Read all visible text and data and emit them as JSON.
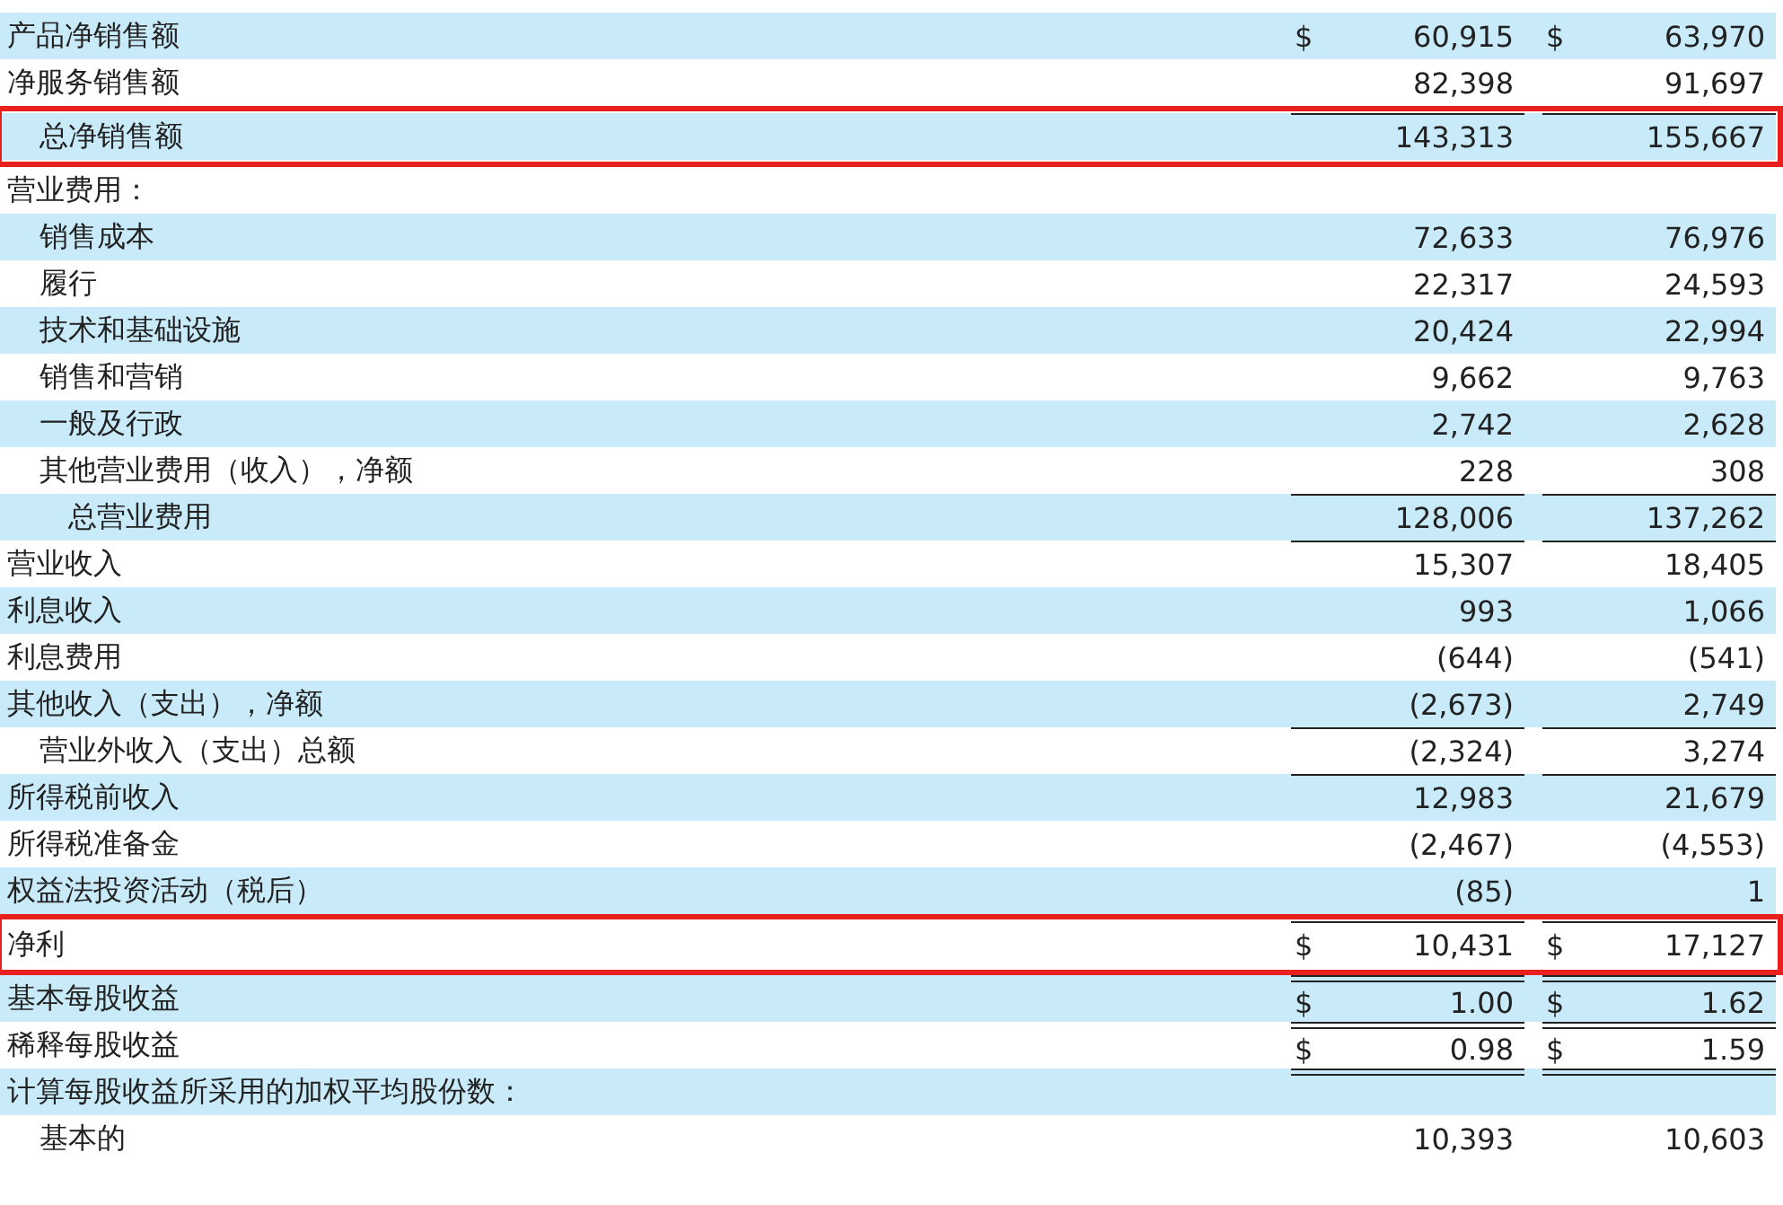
{
  "table": {
    "rows": [
      {
        "label": "产品净销售额",
        "kind": "line",
        "values": [
          {
            "currency": "$",
            "amount": "60,915"
          },
          {
            "currency": "$",
            "amount": "63,970"
          }
        ]
      },
      {
        "label": "净服务销售额",
        "kind": "line",
        "values": [
          {
            "amount": "82,398"
          },
          {
            "amount": "91,697"
          }
        ]
      },
      {
        "label": "总净销售额",
        "kind": "total",
        "rule_above": true,
        "highlighted": true,
        "values": [
          {
            "amount": "143,313"
          },
          {
            "amount": "155,667"
          }
        ]
      },
      {
        "label": "营业费用：",
        "kind": "header",
        "children": [
          {
            "label": "销售成本",
            "kind": "line",
            "values": [
              {
                "amount": "72,633"
              },
              {
                "amount": "76,976"
              }
            ]
          },
          {
            "label": "履行",
            "kind": "line",
            "values": [
              {
                "amount": "22,317"
              },
              {
                "amount": "24,593"
              }
            ]
          },
          {
            "label": "技术和基础设施",
            "kind": "line",
            "values": [
              {
                "amount": "20,424"
              },
              {
                "amount": "22,994"
              }
            ]
          },
          {
            "label": "销售和营销",
            "kind": "line",
            "values": [
              {
                "amount": "9,662"
              },
              {
                "amount": "9,763"
              }
            ]
          },
          {
            "label": "一般及行政",
            "kind": "line",
            "values": [
              {
                "amount": "2,742"
              },
              {
                "amount": "2,628"
              }
            ]
          },
          {
            "label": "其他营业费用（收入），净额",
            "kind": "line",
            "values": [
              {
                "amount": "228"
              },
              {
                "amount": "308"
              }
            ]
          },
          {
            "label": "总营业费用",
            "kind": "total",
            "rule_above": true,
            "values": [
              {
                "amount": "128,006"
              },
              {
                "amount": "137,262"
              }
            ]
          }
        ]
      },
      {
        "label": "营业收入",
        "kind": "line",
        "rule_above": true,
        "values": [
          {
            "amount": "15,307"
          },
          {
            "amount": "18,405"
          }
        ]
      },
      {
        "label": "利息收入",
        "kind": "line",
        "values": [
          {
            "amount": "993"
          },
          {
            "amount": "1,066"
          }
        ]
      },
      {
        "label": "利息费用",
        "kind": "line",
        "values": [
          {
            "amount": "(644)"
          },
          {
            "amount": "(541)"
          }
        ]
      },
      {
        "label": "其他收入（支出），净额",
        "kind": "line",
        "values": [
          {
            "amount": "(2,673)"
          },
          {
            "amount": "2,749"
          }
        ]
      },
      {
        "label": "营业外收入（支出）总额",
        "kind": "total",
        "rule_above": true,
        "values": [
          {
            "amount": "(2,324)"
          },
          {
            "amount": "3,274"
          }
        ]
      },
      {
        "label": "所得税前收入",
        "kind": "line",
        "rule_above": true,
        "values": [
          {
            "amount": "12,983"
          },
          {
            "amount": "21,679"
          }
        ]
      },
      {
        "label": "所得税准备金",
        "kind": "line",
        "values": [
          {
            "amount": "(2,467)"
          },
          {
            "amount": "(4,553)"
          }
        ]
      },
      {
        "label": "权益法投资活动（税后）",
        "kind": "line",
        "values": [
          {
            "amount": "(85)"
          },
          {
            "amount": "1"
          }
        ]
      },
      {
        "label": "净利",
        "kind": "line",
        "rule_above": true,
        "highlighted": true,
        "values": [
          {
            "currency": "$",
            "amount": "10,431"
          },
          {
            "currency": "$",
            "amount": "17,127"
          }
        ]
      },
      {
        "label": "基本每股收益",
        "kind": "line",
        "rule_above": true,
        "double_rule": true,
        "values": [
          {
            "currency": "$",
            "amount": "1.00"
          },
          {
            "currency": "$",
            "amount": "1.62"
          }
        ]
      },
      {
        "label": "稀释每股收益",
        "kind": "line",
        "rule_above": true,
        "double_rule": true,
        "values": [
          {
            "currency": "$",
            "amount": "0.98"
          },
          {
            "currency": "$",
            "amount": "1.59"
          }
        ]
      },
      {
        "label": "计算每股收益所采用的加权平均股份数：",
        "kind": "header",
        "rule_above": true,
        "double_rule": true,
        "children": [
          {
            "label": "基本的",
            "kind": "line",
            "values": [
              {
                "amount": "10,393"
              },
              {
                "amount": "10,603"
              }
            ]
          }
        ]
      }
    ]
  }
}
